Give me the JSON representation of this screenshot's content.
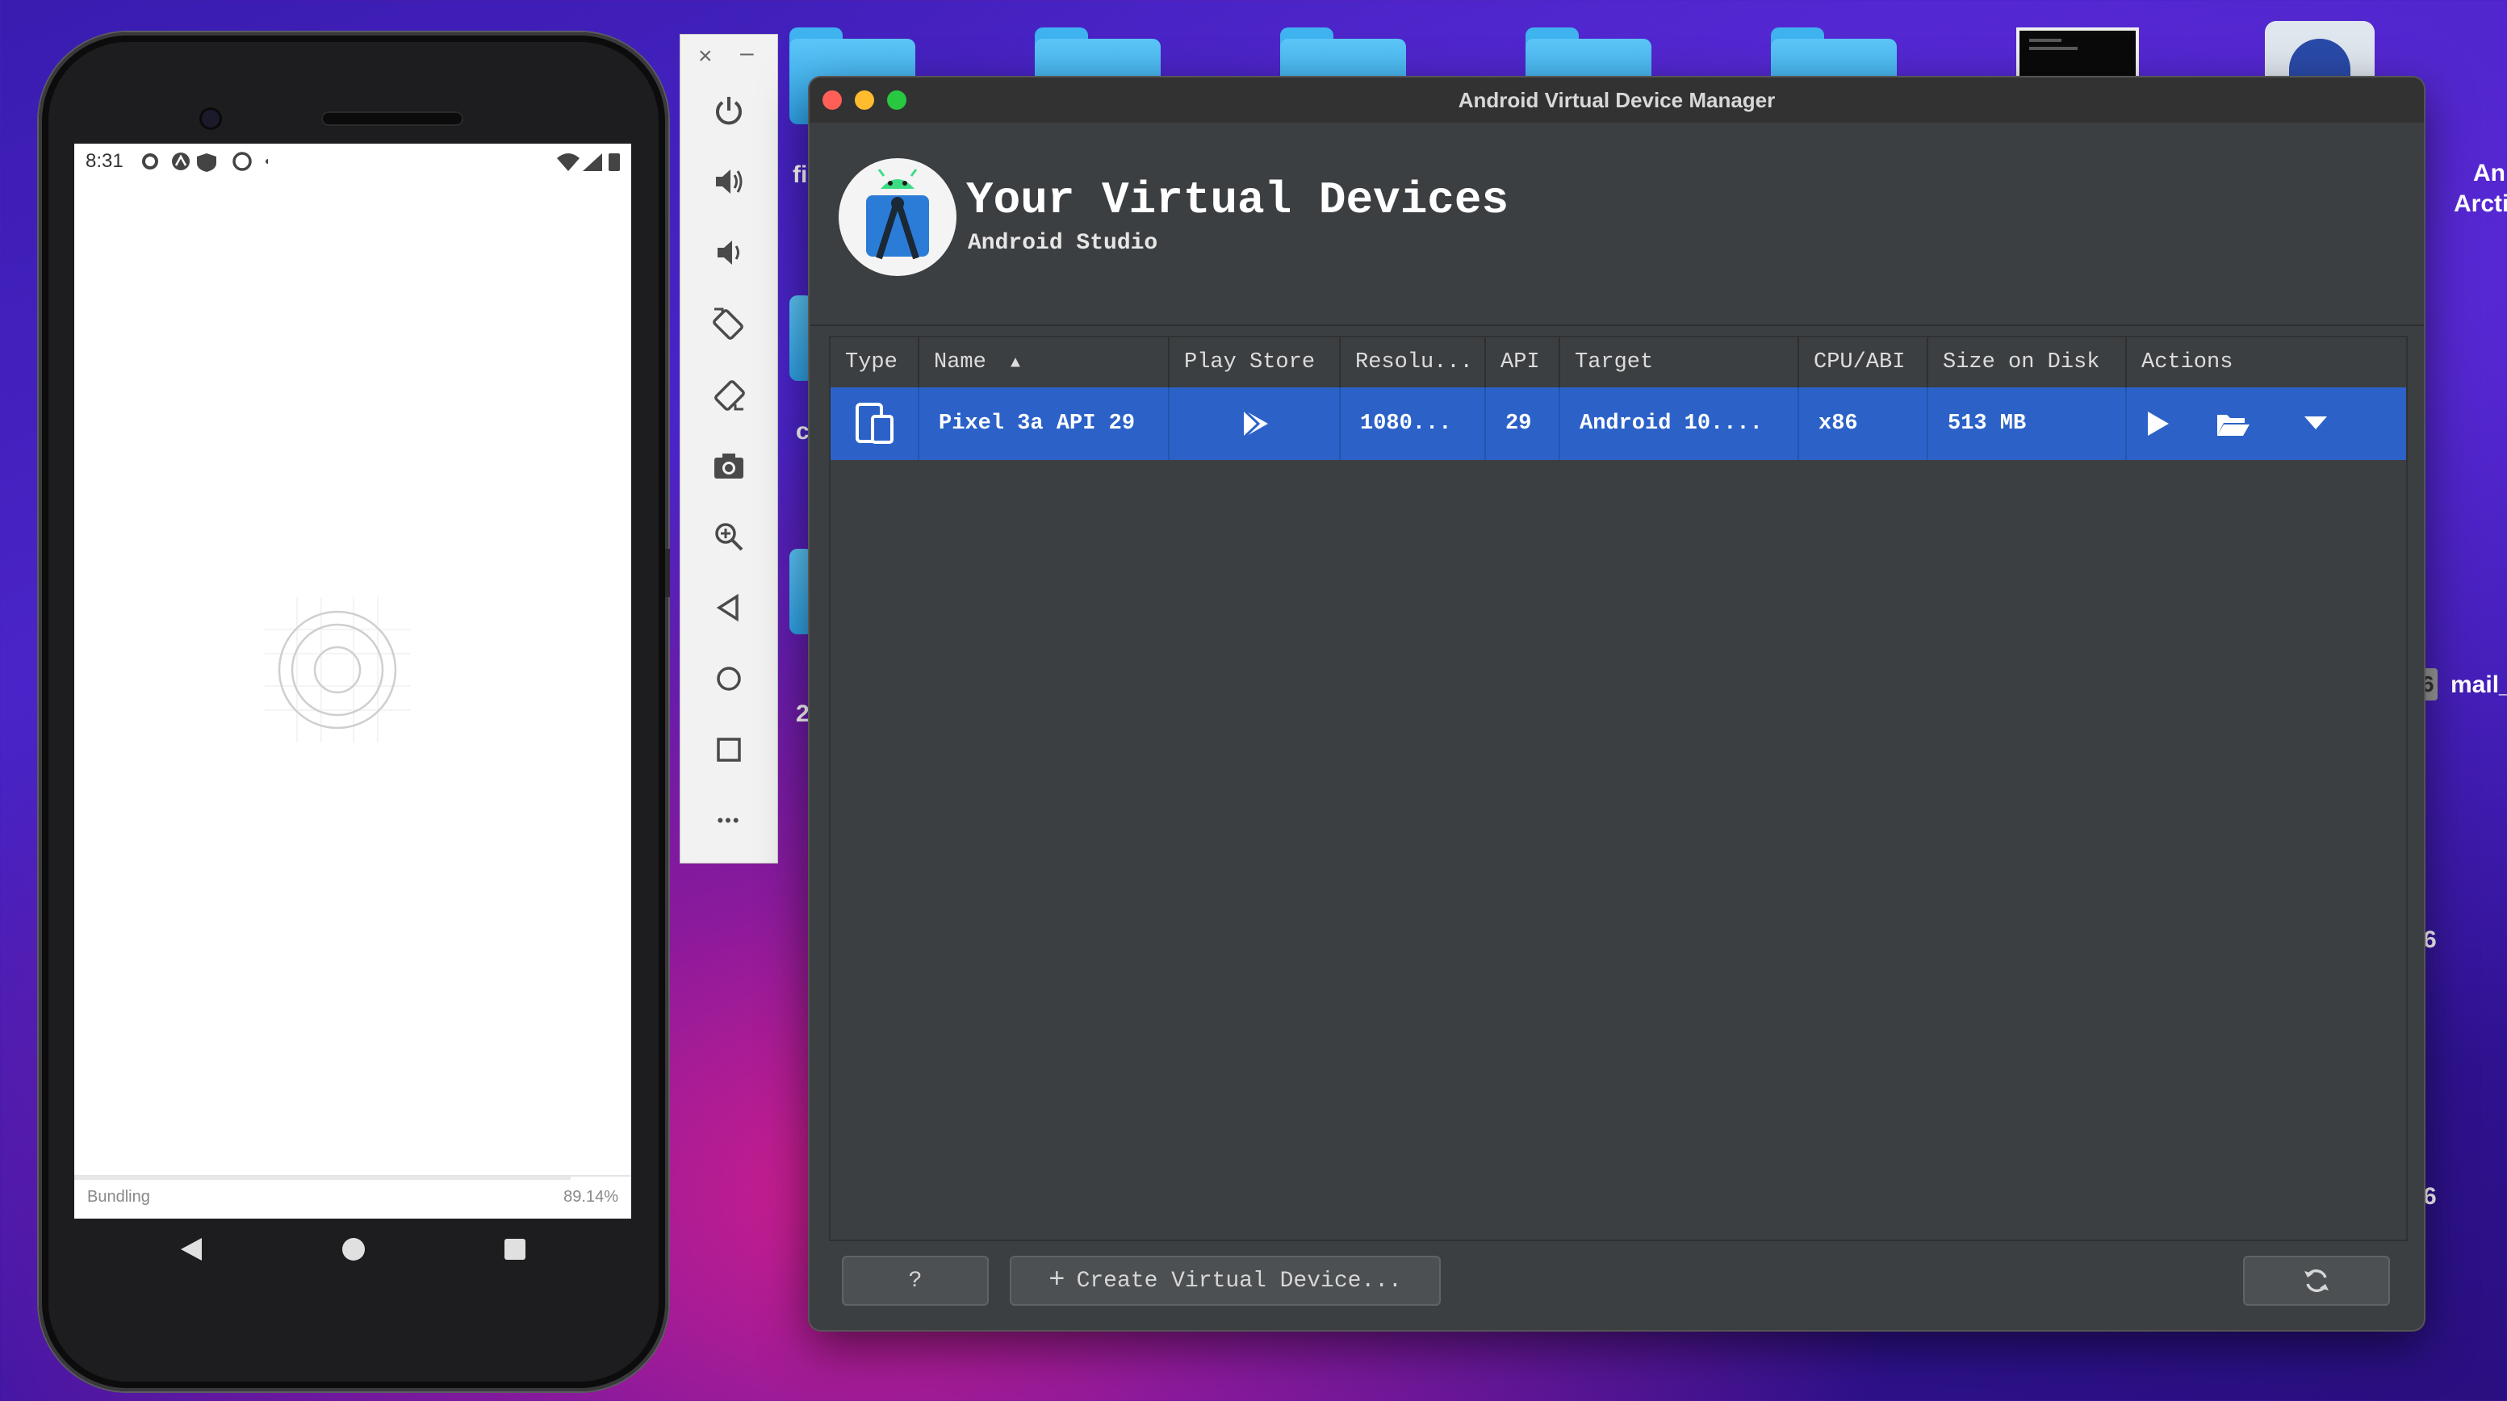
{
  "desktop": {
    "labels": [
      "fi",
      "c",
      "2",
      "An",
      "Arcti",
      "mail_",
      "6",
      "6",
      "6"
    ]
  },
  "phone": {
    "time": "8:31",
    "bundling_label": "Bundling",
    "bundling_percent": "89.14%",
    "progress": 0.8914
  },
  "emulator_toolbar": {
    "close_glyph": "×",
    "minimize_glyph": "–",
    "more_glyph": "•••"
  },
  "window": {
    "title": "Android Virtual Device Manager",
    "header_title": "Your Virtual Devices",
    "header_subtitle": "Android Studio",
    "colors": {
      "selection": "#2c62c8",
      "close": "#ff5f57",
      "minimize": "#febc2e",
      "zoom": "#28c840"
    }
  },
  "table": {
    "columns": {
      "type": "Type",
      "name": "Name",
      "play_store": "Play Store",
      "resolution": "Resolu...",
      "api": "API",
      "target": "Target",
      "cpu": "CPU/ABI",
      "size": "Size on Disk",
      "actions": "Actions"
    },
    "sort_indicator": "▲",
    "rows": [
      {
        "name": "Pixel 3a API 29",
        "resolution": "1080...",
        "api": "29",
        "target": "Android 10....",
        "cpu": "x86",
        "size": "513 MB"
      }
    ]
  },
  "footer": {
    "help_label": "?",
    "create_label": "Create Virtual Device..."
  }
}
